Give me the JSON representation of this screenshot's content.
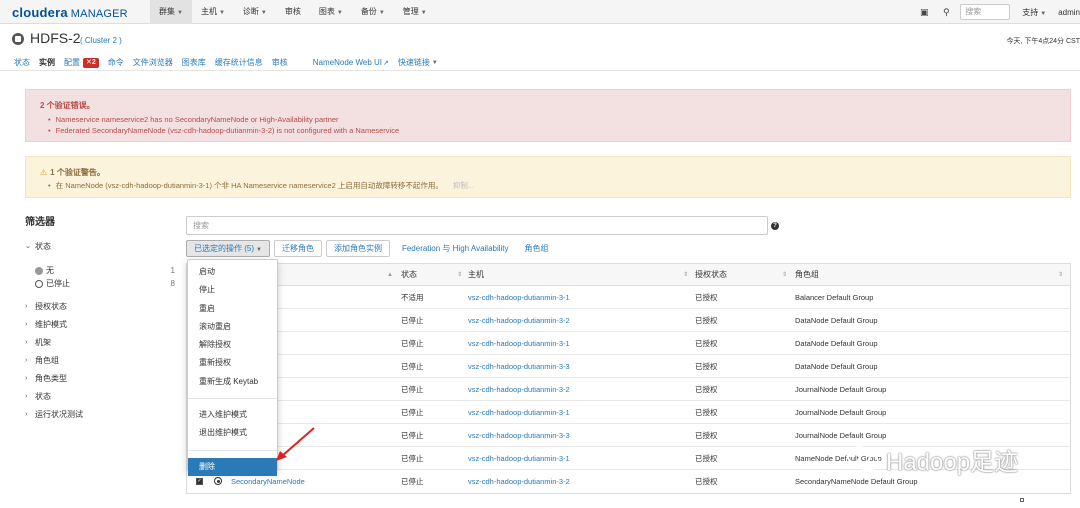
{
  "topnav": {
    "logo_brand": "cloudera",
    "logo_product": "MANAGER",
    "menu": [
      "群集",
      "主机",
      "诊断",
      "审核",
      "图表",
      "备份",
      "管理"
    ],
    "search_placeholder": "搜索",
    "support": "支持",
    "user": "admin"
  },
  "service": {
    "name": "HDFS-2",
    "cluster": "( Cluster 2 )",
    "time": "今天, 下午4点24分 CST"
  },
  "tabs": {
    "status": "状态",
    "instances": "实例",
    "config": "配置",
    "config_badge": "2",
    "commands": "命令",
    "file_browser": "文件浏览器",
    "charts": "图表库",
    "cache_stats": "缓存统计信息",
    "audit": "审核",
    "namenode_ui": "NameNode Web UI",
    "quick_links": "快速链接"
  },
  "alerts": {
    "error_title": "2 个验证错误。",
    "errors": [
      "Nameservice nameservice2 has no SecondaryNameNode or High-Availability partner",
      "Federated SecondaryNameNode (vsz-cdh-hadoop-dutianmin-3-2) is not configured with a Nameservice"
    ],
    "warning_title": "1 个验证警告。",
    "warning": "在 NameNode (vsz-cdh-hadoop-dutianmin-3-1) 个非 HA Nameservice nameservice2 上启用自动故障转移不起作用。",
    "warning_dismiss": "抑制..."
  },
  "filter": {
    "title": "筛选器",
    "status_group": "状态",
    "options": [
      {
        "label": "无",
        "count": "1",
        "color": "#999999"
      },
      {
        "label": "已停止",
        "count": "8",
        "color": "#555555"
      }
    ],
    "groups": [
      "授权状态",
      "维护模式",
      "机架",
      "角色组",
      "角色类型",
      "状态",
      "运行状况测试"
    ]
  },
  "main": {
    "search_placeholder": "搜索",
    "actions_button": "已选定的操作 (5)",
    "migrate": "迁移角色",
    "add_role": "添加角色实例",
    "federation": "Federation 与 High Availability",
    "role_groups": "角色组"
  },
  "table": {
    "headers": {
      "status": "状态",
      "host": "主机",
      "auth": "授权状态",
      "group": "角色组"
    },
    "rows": [
      {
        "status": "不适用",
        "host": "vsz-cdh-hadoop-dutianmin-3-1",
        "auth": "已授权",
        "group": "Balancer Default Group"
      },
      {
        "status": "已停止",
        "host": "vsz-cdh-hadoop-dutianmin-3-2",
        "auth": "已授权",
        "group": "DataNode Default Group"
      },
      {
        "status": "已停止",
        "host": "vsz-cdh-hadoop-dutianmin-3-1",
        "auth": "已授权",
        "group": "DataNode Default Group"
      },
      {
        "status": "已停止",
        "host": "vsz-cdh-hadoop-dutianmin-3-3",
        "auth": "已授权",
        "group": "DataNode Default Group"
      },
      {
        "status": "已停止",
        "host": "vsz-cdh-hadoop-dutianmin-3-2",
        "auth": "已授权",
        "group": "JournalNode Default Group"
      },
      {
        "status": "已停止",
        "host": "vsz-cdh-hadoop-dutianmin-3-1",
        "auth": "已授权",
        "group": "JournalNode Default Group"
      },
      {
        "status": "已停止",
        "host": "vsz-cdh-hadoop-dutianmin-3-3",
        "auth": "已授权",
        "group": "JournalNode Default Group"
      },
      {
        "status": "已停止",
        "host": "vsz-cdh-hadoop-dutianmin-3-1",
        "auth": "已授权",
        "group": "NameNode Default Group"
      },
      {
        "role": "SecondaryNameNode",
        "status": "已停止",
        "host": "vsz-cdh-hadoop-dutianmin-3-2",
        "auth": "已授权",
        "group": "SecondaryNameNode Default Group"
      }
    ]
  },
  "dropdown": {
    "items": [
      "启动",
      "停止",
      "重启",
      "滚动重启",
      "解除授权",
      "重新授权",
      "重新生成 Keytab"
    ],
    "maint_items": [
      "进入维护模式",
      "退出维护模式"
    ],
    "delete": "删除"
  },
  "watermark": "Hadoop足迹"
}
